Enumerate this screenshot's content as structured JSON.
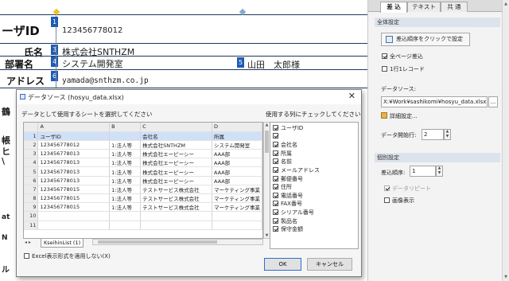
{
  "document": {
    "rows": [
      {
        "label": "ーザID",
        "value": "123456778012",
        "num": "1"
      },
      {
        "label": "氏名",
        "value": "株式会社SNTHZM",
        "num": "3"
      },
      {
        "label": "部署名",
        "value": "システム開発室",
        "num": "4"
      },
      {
        "label": "アドレス",
        "value": "yamada@snthzm.co.jp",
        "num": "6"
      }
    ],
    "extra_num": "5",
    "extra_value": "山田　太郎様",
    "left_fragments": [
      "鶴",
      "帳",
      "ヒ",
      "\\"
    ],
    "bottom_fragments": [
      "at",
      "N",
      "ル"
    ]
  },
  "dialog": {
    "title": "データソース (hosyu_data.xlsx)",
    "close": "✕",
    "sheet_prompt": "データとして使用するシートを選択してください",
    "col_prompt": "使用する列にチェックしてください",
    "grid": {
      "col_headers": [
        "",
        "A",
        "B",
        "C",
        "D"
      ],
      "rows": [
        [
          "1",
          "ユーザID",
          "",
          "会社名",
          "所属"
        ],
        [
          "2",
          "123456778012",
          "1:法人等",
          "株式会社SNTHZM",
          "システム開発室"
        ],
        [
          "3",
          "123456778013",
          "1:法人等",
          "株式会社エーピーシー",
          "AAA部"
        ],
        [
          "4",
          "123456778013",
          "1:法人等",
          "株式会社エーピーシー",
          "AAA部"
        ],
        [
          "5",
          "123456778013",
          "1:法人等",
          "株式会社エーピーシー",
          "AAA部"
        ],
        [
          "6",
          "123456778013",
          "1:法人等",
          "株式会社エーピーシー",
          "AAA部"
        ],
        [
          "7",
          "123456778015",
          "1:法人等",
          "テストサービス株式会社",
          "マーケティング事業"
        ],
        [
          "8",
          "123456778015",
          "1:法人等",
          "テストサービス株式会社",
          "マーケティング事業"
        ],
        [
          "9",
          "123456778015",
          "1:法人等",
          "テストサービス株式会社",
          "マーケティング事業"
        ],
        [
          "10",
          "",
          "",
          "",
          ""
        ],
        [
          "11",
          "",
          "",
          "",
          ""
        ]
      ]
    },
    "sheet_nav": "◂ ▸",
    "sheet_tab": "KseihinList (1)",
    "columns": [
      {
        "label": "ユーザID",
        "checked": true
      },
      {
        "label": "",
        "checked": true
      },
      {
        "label": "会社名",
        "checked": true
      },
      {
        "label": "所属",
        "checked": true
      },
      {
        "label": "名前",
        "checked": true
      },
      {
        "label": "メールアドレス",
        "checked": true
      },
      {
        "label": "郵便番号",
        "checked": true
      },
      {
        "label": "住所",
        "checked": true
      },
      {
        "label": "電話番号",
        "checked": true
      },
      {
        "label": "FAX番号",
        "checked": true
      },
      {
        "label": "シリアル番号",
        "checked": true
      },
      {
        "label": "製品名",
        "checked": true
      },
      {
        "label": "保守金額",
        "checked": true
      }
    ],
    "excel_format_label": "Excel表示形式を適用しない(X)",
    "ok": "OK",
    "cancel": "キャンセル"
  },
  "panel": {
    "tabs": [
      "差 込",
      "テキスト",
      "共 通"
    ],
    "section_all": "全体設定",
    "order_button": "差込順序をクリックで設定",
    "all_pages": "全ページ差込",
    "one_line": "1行1レコード",
    "datasource_label": "データソース:",
    "datasource_path": "X:¥Work¥sashikomi¥hosyu_data.xlsx",
    "browse": "...",
    "detail_settings": "詳細設定...",
    "start_row_label": "データ開始行:",
    "start_row_value": "2",
    "section_individual": "個別設定",
    "order_label": "差込順序:",
    "order_value": "1",
    "data_repeat": "データリピート",
    "image_display": "画像表示"
  }
}
